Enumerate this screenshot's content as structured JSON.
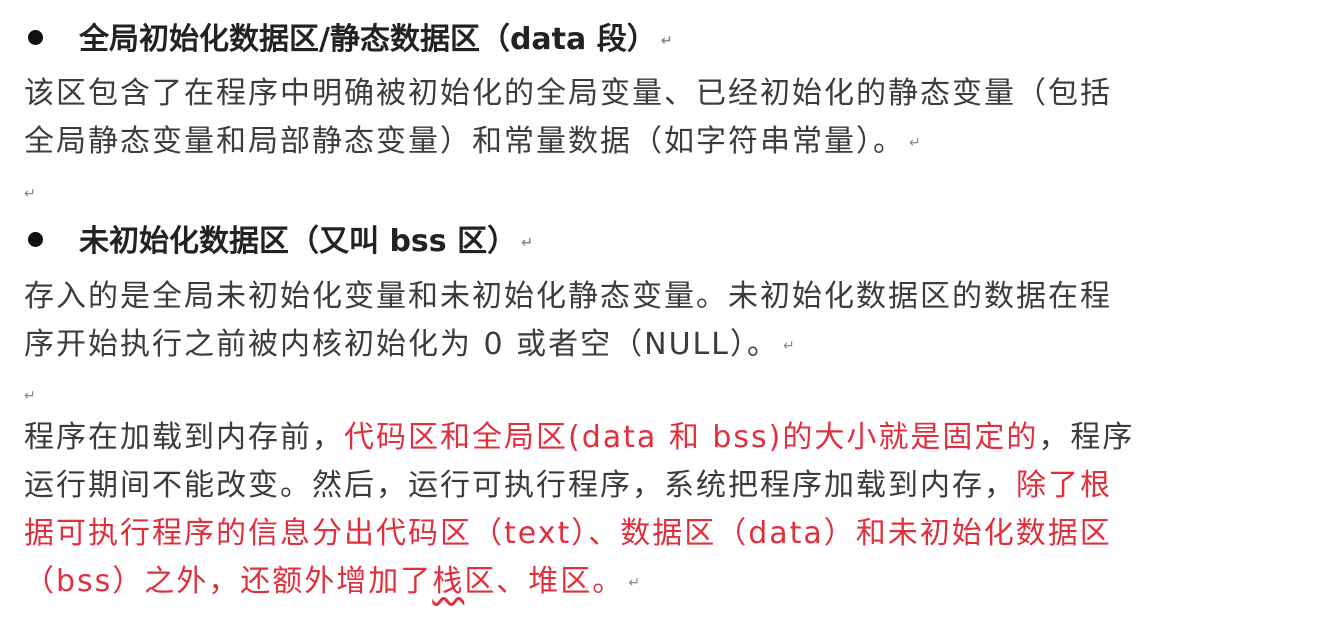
{
  "section1": {
    "heading": "全局初始化数据区/静态数据区（data 段）",
    "lines": [
      "该区包含了在程序中明确被初始化的全局变量、已经初始化的静态变量（包括",
      "全局静态变量和局部静态变量）和常量数据（如字符串常量）。"
    ]
  },
  "section2": {
    "heading": "未初始化数据区（又叫 bss 区）",
    "lines": [
      "存入的是全局未初始化变量和未初始化静态变量。未初始化数据区的数据在程",
      "序开始执行之前被内核初始化为 0 或者空（NULL）。"
    ]
  },
  "paragraph3": {
    "line1_a": "程序在加载到内存前，",
    "line1_b": "代码区和全局区(data 和 bss)的大小就是固定的",
    "line1_c": "，程序",
    "line2_a": "运行期间不能改变。然后，运行可执行程序，系统把程序加载到内存，",
    "line2_b": "除了根",
    "line3": "据可执行程序的信息分出代码区（text）、数据区（data）和未初始化数据区",
    "line4_a": "（bss）之外，还额外增加了",
    "line4_b": "栈",
    "line4_c": "区、堆区。"
  },
  "paragraph_mark": "↵",
  "colors": {
    "text": "#3c3c3c",
    "heading": "#222222",
    "highlight": "#e0303e"
  }
}
